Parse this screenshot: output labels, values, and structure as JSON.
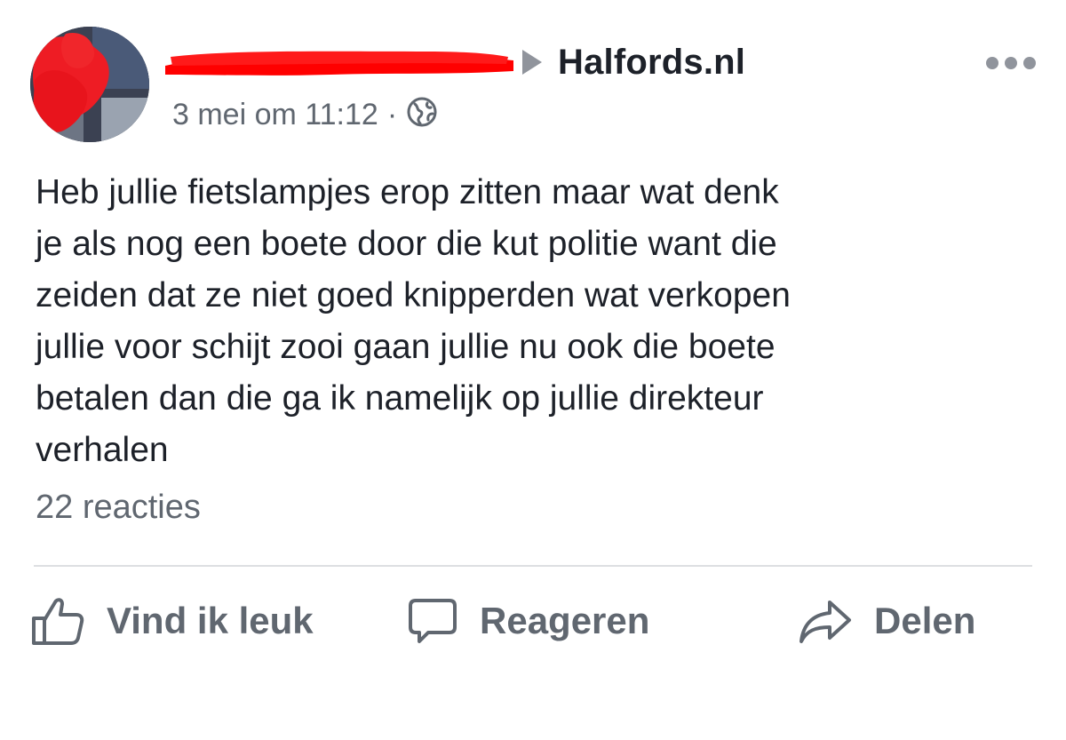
{
  "post": {
    "author_redacted": true,
    "target_page": "Halfords.nl",
    "timestamp": "3 mei om 11:12",
    "separator": "·",
    "privacy_icon": "globe-icon",
    "body": "Heb jullie fietslampjes erop zitten maar wat denk\nje als nog een boete door die kut politie want die\nzeiden dat ze niet goed knipperden wat verkopen\njullie voor schijt zooi gaan jullie nu ook die boete\nbetalen dan die ga ik namelijk op jullie direkteur\nverhalen",
    "reaction_summary": "22 reacties",
    "menu_icon": "more-options-icon"
  },
  "actions": {
    "like_label": "Vind ik leuk",
    "comment_label": "Reageren",
    "share_label": "Delen"
  },
  "colors": {
    "text_primary": "#1d2129",
    "text_secondary": "#606770",
    "icon_gray": "#90949c",
    "redaction_red": "#ff0000",
    "divider": "#dddfe2"
  }
}
